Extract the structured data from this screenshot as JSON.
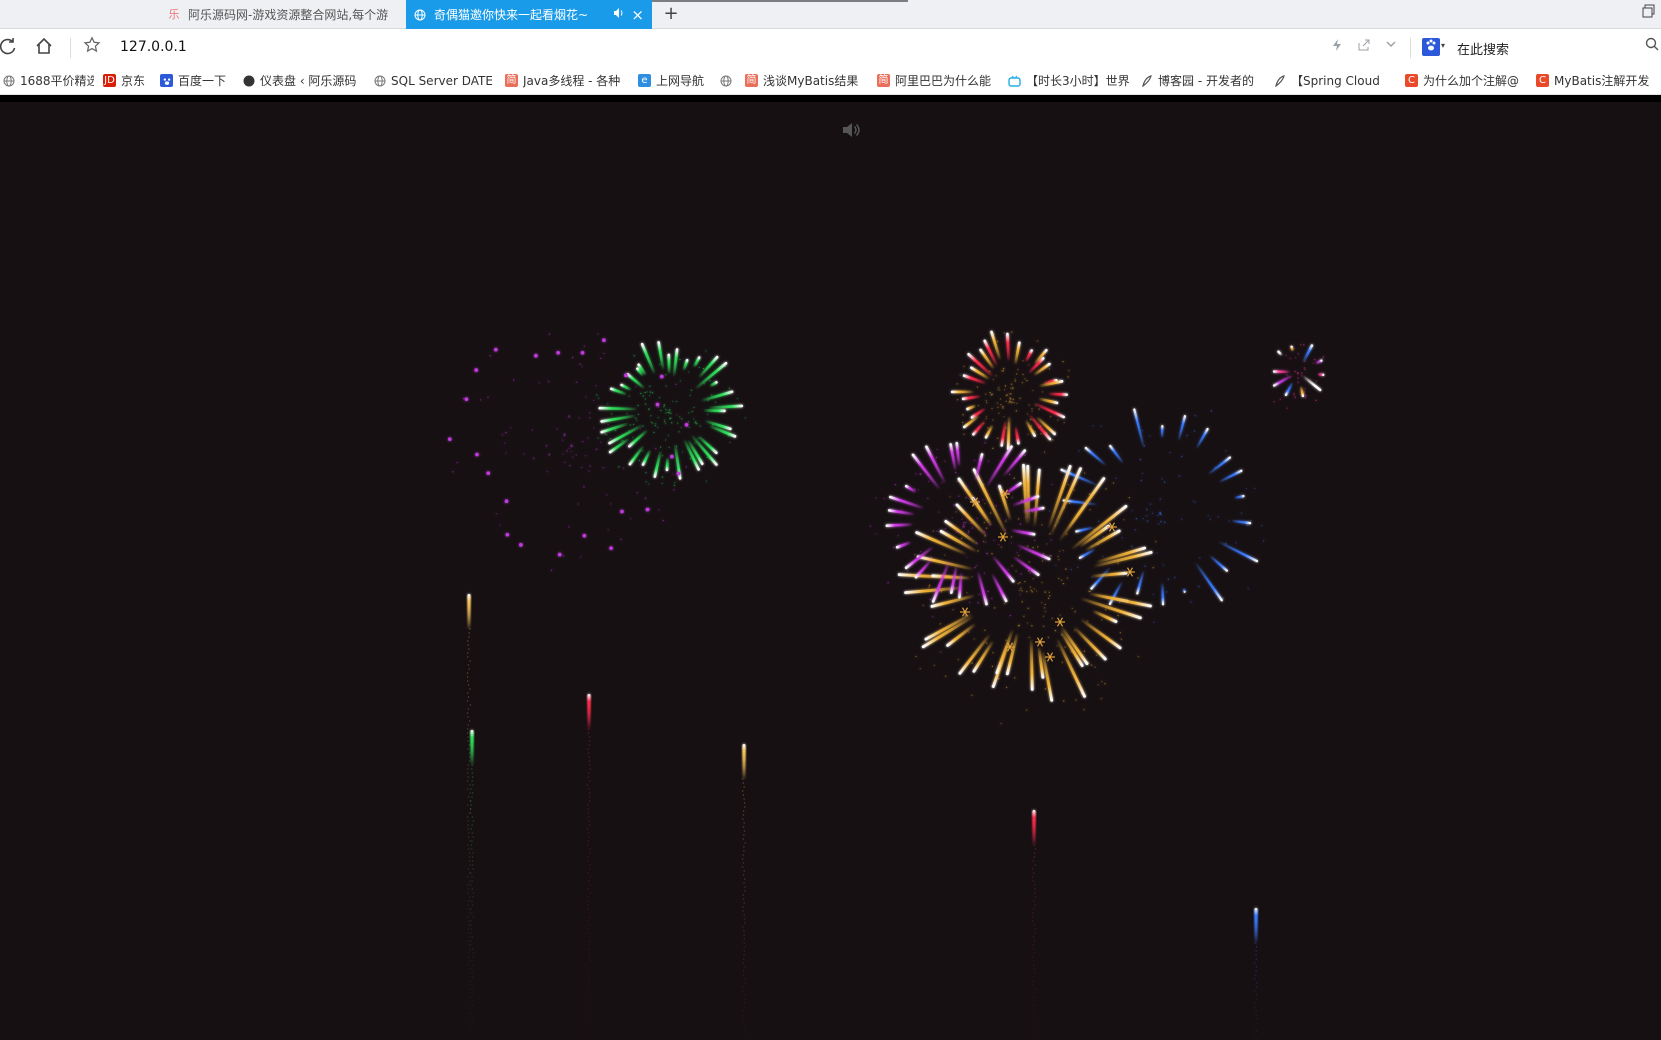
{
  "tabs": [
    {
      "title": "阿乐源码网-游戏资源整合网站,每个游",
      "favicon": "乐",
      "active": false
    },
    {
      "title": "奇偶猫邀你快来一起看烟花~",
      "favicon": "globe-icon",
      "active": true,
      "audio": "speaker-icon",
      "close": "×"
    }
  ],
  "new_tab_label": "+",
  "address_bar": {
    "url": "127.0.0.1",
    "search_placeholder": "在此搜索"
  },
  "bookmarks": [
    {
      "label": "1688平价精选",
      "icon": "globe-icon",
      "color": "#777777"
    },
    {
      "label": "京东",
      "icon": "JD",
      "color": "#d81e06"
    },
    {
      "label": "百度一下",
      "icon": "paw-icon",
      "color": "#2b59d9"
    },
    {
      "label": "仪表盘 ‹ 阿乐源码",
      "icon": "circle-icon",
      "color": "#333333"
    },
    {
      "label": "SQL Server DATE",
      "icon": "globe-icon",
      "color": "#777777"
    },
    {
      "label": "Java多线程 - 各种",
      "icon": "简",
      "color": "#ea6f5a"
    },
    {
      "label": "上网导航",
      "icon": "e",
      "color": "#2f8ee0"
    },
    {
      "label": "",
      "icon": "globe-icon",
      "color": "#777777"
    },
    {
      "label": "浅谈MyBatis结果",
      "icon": "简",
      "color": "#ea6f5a"
    },
    {
      "label": "阿里巴巴为什么能",
      "icon": "简",
      "color": "#ea6f5a"
    },
    {
      "label": "【时长3小时】世界",
      "icon": "tv-icon",
      "color": "#23ade5"
    },
    {
      "label": "博客园 - 开发者的",
      "icon": "feather-icon",
      "color": "#555555"
    },
    {
      "label": "【Spring Cloud",
      "icon": "feather-icon",
      "color": "#555555"
    },
    {
      "label": "为什么加个注解@",
      "icon": "C",
      "color": "#e94a2a"
    },
    {
      "label": "MyBatis注解开发",
      "icon": "C",
      "color": "#e94a2a"
    }
  ],
  "content": {
    "sound_toggle": "speaker-icon",
    "background": "#171013"
  },
  "fireworks": {
    "bursts": [
      {
        "name": "burst-green",
        "color": "#2ee05a",
        "style": "streaks"
      },
      {
        "name": "burst-purple-faint",
        "color": "#c33be0",
        "style": "dots"
      },
      {
        "name": "burst-red-gold",
        "color": "#ff2b4a",
        "color2": "#f0b23a",
        "style": "streaks"
      },
      {
        "name": "burst-blue",
        "color": "#3a7bff",
        "style": "streaks"
      },
      {
        "name": "burst-gold-large",
        "color": "#f0b23a",
        "style": "streaks"
      },
      {
        "name": "burst-purple",
        "color": "#d13be8",
        "style": "streaks"
      },
      {
        "name": "burst-multicolor-small",
        "color": "#ff3fa0",
        "style": "streaks"
      }
    ],
    "rockets": [
      {
        "name": "rocket-gold-left",
        "color": "#f2c25a"
      },
      {
        "name": "rocket-red",
        "color": "#ff2b4a"
      },
      {
        "name": "rocket-green",
        "color": "#2ee05a"
      },
      {
        "name": "rocket-gold",
        "color": "#f2c25a"
      },
      {
        "name": "rocket-red-right",
        "color": "#ff2b4a"
      },
      {
        "name": "rocket-blue",
        "color": "#3a7bff"
      }
    ]
  }
}
